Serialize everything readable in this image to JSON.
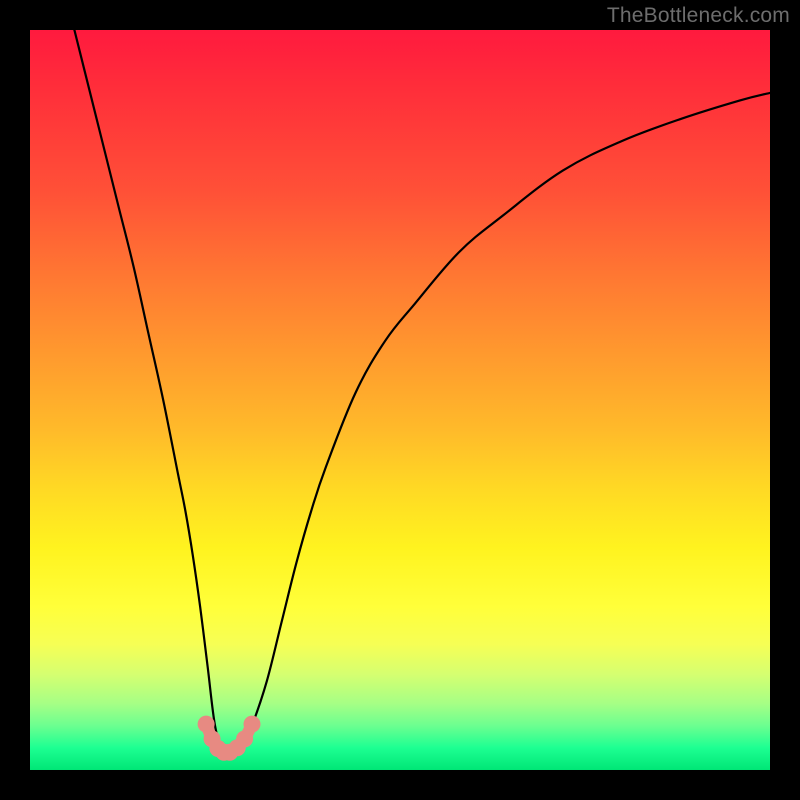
{
  "watermark": "TheBottleneck.com",
  "chart_data": {
    "type": "line",
    "title": "",
    "xlabel": "",
    "ylabel": "",
    "xlim": [
      0,
      100
    ],
    "ylim": [
      0,
      100
    ],
    "grid": false,
    "series": [
      {
        "name": "bottleneck-curve",
        "color": "#000000",
        "x": [
          6,
          8,
          10,
          12,
          14,
          16,
          18,
          20,
          21,
          22,
          23,
          24,
          25,
          26,
          27,
          28,
          29,
          30,
          32,
          34,
          36,
          38,
          40,
          44,
          48,
          52,
          58,
          64,
          72,
          80,
          88,
          96,
          100
        ],
        "values": [
          100,
          92,
          84,
          76,
          68,
          59,
          50,
          40,
          35,
          29,
          22,
          14,
          6,
          3,
          2,
          2.5,
          4,
          6,
          12,
          20,
          28,
          35,
          41,
          51,
          58,
          63,
          70,
          75,
          81,
          85,
          88,
          90.5,
          91.5
        ]
      },
      {
        "name": "highlight-dots",
        "color": "#e78a82",
        "x": [
          23.8,
          24.6,
          25.4,
          26.2,
          27.0,
          28.0,
          29.0,
          30.0
        ],
        "values": [
          6.2,
          4.2,
          2.9,
          2.4,
          2.4,
          3.0,
          4.2,
          6.2
        ]
      }
    ],
    "annotations": [
      {
        "text": "TheBottleneck.com",
        "position": "top-right"
      }
    ]
  }
}
